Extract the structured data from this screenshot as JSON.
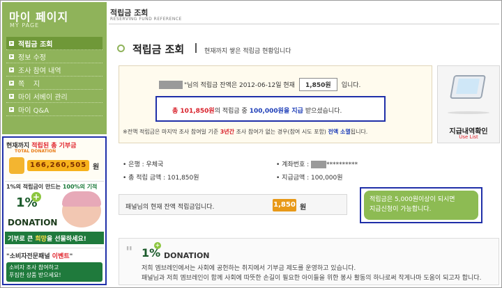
{
  "sidebar": {
    "title": "마이 페이지",
    "subtitle": "MY PAGE",
    "items": [
      {
        "label": "적립금 조회",
        "active": true
      },
      {
        "label": "정보 수정",
        "active": false
      },
      {
        "label": "조사 참여 내역",
        "active": false
      },
      {
        "label": "쪽    지",
        "active": false
      },
      {
        "label": "마이 서베이 관리",
        "active": false
      },
      {
        "label": "마이 Q&A",
        "active": false
      }
    ]
  },
  "banners": {
    "donation_total": {
      "title_pre": "현재까지 ",
      "title_red": "적립된 총 기부금",
      "subtitle": "TOTAL DONATION",
      "amount": "166,260,505",
      "unit": "원"
    },
    "donation_ad": {
      "title_pre": "1%의 적립금이 만드는 ",
      "title_green": "100%의 기적",
      "logo": "1%",
      "logo_word": "DONATION",
      "bar_pre": "기부로 큰 ",
      "bar_yellow": "희망",
      "bar_post": "을 선물하세요!"
    },
    "event": {
      "title_pre": "\"소비자전문패널 ",
      "title_red": "이벤트",
      "title_post": "\"",
      "line1": "소비자 조사 참여하고",
      "line2": "푸짐한 상품 받으세요!"
    }
  },
  "header": {
    "title": "적립금 조회",
    "subtitle": "RESERVING FUND REFERENCE"
  },
  "page": {
    "title": "적립금 조회",
    "description": "현재까지 쌓은 적립금 현황입니다"
  },
  "balance": {
    "prefix": "\"",
    "mid": "\"님의 적립금 잔액은 2012-06-12일 현재",
    "value": "1,850원",
    "suffix": "입니다."
  },
  "total": {
    "pre": "총 ",
    "total_amount": "101,850원",
    "mid": "의 적립금 중 ",
    "received": "100,000원",
    "emph": "을 지급",
    "post": " 받으셨습니다."
  },
  "note": {
    "pre": "※전액 적립금은 마지막 조사 참여일 기준 ",
    "red": "3년간",
    "mid": " 조사 참여가 없는 경우(참여 시도 포함) ",
    "navy": "전액 소멸",
    "post": "됩니다."
  },
  "side_card": {
    "title": "지급내역확인",
    "subtitle": "Use List"
  },
  "info": {
    "bank_label": "• 은행 : 우체국",
    "account_label": "• 계좌번호 :",
    "account_mask": "**********",
    "total_label": "• 총 적립 금액 : 101,850원",
    "paid_label": "• 지급금액 : 100,000원"
  },
  "summary": {
    "text": "패널님의 현재 잔액 적립금입니다.",
    "amount": "1,850",
    "unit": "원"
  },
  "notice": {
    "line1": "적립금은 5,000원이상이 되시면",
    "line2": "지급신청이 가능합니다."
  },
  "donation": {
    "logo": "1%",
    "word": "DONATION",
    "line1": "저희 엠브레인에서는 사회에 공헌하는 취지에서 기부금 제도를 운영하고 있습니다.",
    "line2": "패널님과 저희 엠브레인이 함께 사회에 따뜻한 손길이 필요한 아이들을 위한 봉사 활동의 하나로써 작게나마 도움이 되고자 합니다."
  }
}
